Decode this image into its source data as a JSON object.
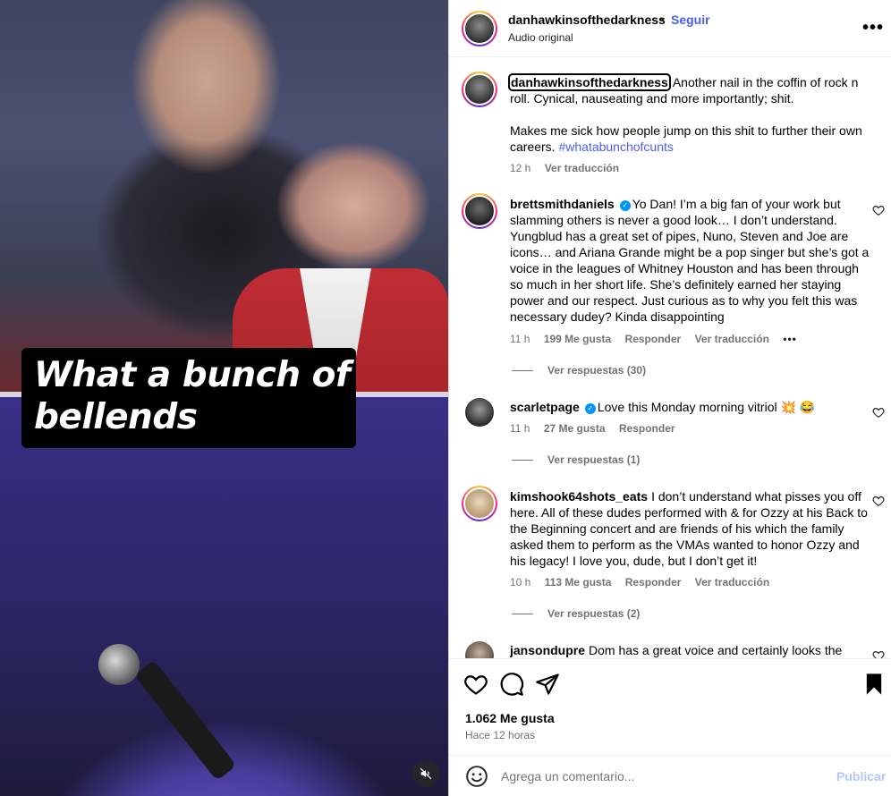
{
  "media": {
    "caption": "What a bunch of bellends",
    "mute_icon": "speaker-muted-icon"
  },
  "header": {
    "username": "danhawkinsofthedarkness",
    "separator": "•",
    "follow_label": "Seguir",
    "audio_label": "Audio original",
    "more_icon": "more-horizontal-icon"
  },
  "post": {
    "username": "danhawkinsofthedarkness",
    "text": "Another nail in the coffin of rock n roll. Cynical, nauseating and more importantly; shit.",
    "text2": "Makes me sick how people jump on this shit to further their own careers.",
    "hashtag": "#whatabunchofcunts",
    "time": "12 h",
    "translate": "Ver traducción"
  },
  "comments": [
    {
      "username": "brettsmithdaniels",
      "verified": true,
      "text": "Yo Dan! I’m a big fan of your work but slamming others is never a good look… I don’t understand. Yungblud has a great set of pipes, Nuno, Steven and Joe are icons… and Ariana Grande might be a pop singer but she’s got a voice in the leagues of Whitney Houston and has been through so much in her short life. She’s definitely earned her staying power and our respect. Just curious as to why you felt this was necessary dudey? Kinda disappointing",
      "time": "11 h",
      "likes": "199 Me gusta",
      "reply": "Responder",
      "translate": "Ver traducción",
      "more": "•••",
      "view_replies": "Ver respuestas (30)"
    },
    {
      "username": "scarletpage",
      "verified": true,
      "text": "Love this Monday morning vitriol",
      "emojis": "💥 😂",
      "time": "11 h",
      "likes": "27 Me gusta",
      "reply": "Responder",
      "view_replies": "Ver respuestas (1)"
    },
    {
      "username": "kimshook64shots_eats",
      "verified": false,
      "text": "I don’t understand what pisses you off here. All of these dudes performed with & for Ozzy at his Back to the Beginning concert and are friends of his which the family asked them to perform as the VMAs wanted to honor Ozzy and his legacy! I love you, dude, but I don’t get it!",
      "time": "10 h",
      "likes": "113 Me gusta",
      "reply": "Responder",
      "translate": "Ver traducción",
      "view_replies": "Ver respuestas (2)"
    },
    {
      "username": "jansondupre",
      "verified": false,
      "text": "Dom has a great voice and certainly looks the"
    }
  ],
  "actions": {
    "like_icon": "heart-icon",
    "comment_icon": "comment-icon",
    "share_icon": "send-icon",
    "save_icon": "bookmark-icon",
    "likes": "1.062 Me gusta",
    "time": "Hace 12 horas"
  },
  "composer": {
    "emoji_icon": "smiley-icon",
    "placeholder": "Agrega un comentario...",
    "publish_label": "Publicar"
  },
  "colors": {
    "link": "#4a5df9",
    "muted": "#737373",
    "publish_disabled": "#b3c6f7",
    "verified": "#0095f6",
    "caption_bg": "#000000"
  }
}
